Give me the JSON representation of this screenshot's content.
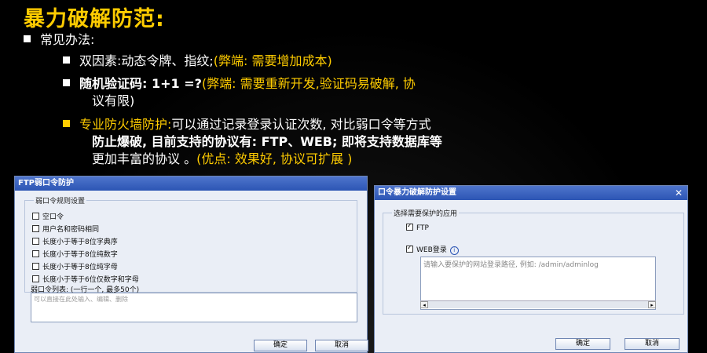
{
  "slide": {
    "title": "暴力破解防范:",
    "b1": "常见办法:",
    "b2_main": "双因素:动态令牌、指纹;",
    "b2_note": "(弊端: 需要增加成本)",
    "b3_main": "随机验证码: 1+1 =?",
    "b3_note1": "(弊端: 需要重新开发,验证码易破解, 协",
    "b3_note2": "议有限)",
    "b4_head": "专业防火墙防护:",
    "b4_l1": "可以通过记录登录认证次数, 对比弱口令等方式",
    "b4_l2": "防止爆破, 目前支持的协议有: FTP、WEB; 即将支持数据库等",
    "b4_l3a": "更加丰富的协议 。",
    "b4_l3b": "(优点: 效果好, 协议可扩展 )"
  },
  "dialog1": {
    "title": "FTP弱口令防护",
    "group_label": "弱口令规则设置",
    "options": [
      "空口令",
      "用户名和密码相同",
      "长度小于等于8位字典序",
      "长度小于等于8位纯数字",
      "长度小于等于8位纯字母",
      "长度小于等于6位仅数字和字母"
    ],
    "list_label": "弱口令列表: (一行一个, 最多50个)",
    "list_placeholder": "可以直接在此处输入、编辑、删除",
    "ok": "确定",
    "cancel": "取消"
  },
  "dialog2": {
    "title": "口令暴力破解防护设置",
    "group_label": "选择需要保护的应用",
    "opt_ftp": "FTP",
    "opt_web": "WEB登录",
    "web_placeholder": "请输入要保护的网站登录路径, 例如: /admin/adminlog",
    "ok": "确定",
    "cancel": "取消"
  },
  "colors": {
    "accent": "#ffcc00",
    "titlebar": "#2c55b4"
  }
}
